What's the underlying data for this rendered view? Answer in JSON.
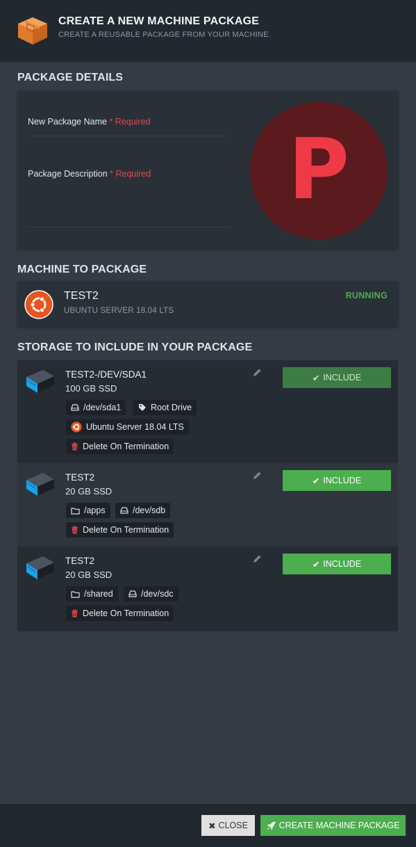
{
  "header": {
    "title": "CREATE A NEW MACHINE PACKAGE",
    "subtitle": "CREATE A REUSABLE PACKAGE FROM YOUR MACHINE.",
    "icon": "package-box-icon"
  },
  "package_details": {
    "title": "PACKAGE DETAILS",
    "name_label": "New Package Name",
    "description_label": "Package Description",
    "required_text": "* Required",
    "name_value": "",
    "description_value": "",
    "logo_letter": "P",
    "colors": {
      "logo_bg": "#5a1a1e",
      "logo_fg": "#ee3a45"
    }
  },
  "machine": {
    "title": "MACHINE TO PACKAGE",
    "name": "TEST2",
    "os": "UBUNTU SERVER 18.04 LTS",
    "status": "RUNNING",
    "icon": "ubuntu-icon"
  },
  "storage": {
    "title": "STORAGE TO INCLUDE IN YOUR PACKAGE",
    "items": [
      {
        "name": "TEST2-/DEV/SDA1",
        "size": "100 GB SSD",
        "include_label": "INCLUDE",
        "tags": {
          "device": "/dev/sda1",
          "role": "Root Drive",
          "os": "Ubuntu Server 18.04 LTS",
          "delete": "Delete On Termination"
        }
      },
      {
        "name": "TEST2",
        "size": "20 GB SSD",
        "include_label": "INCLUDE",
        "tags": {
          "mount": "/apps",
          "device": "/dev/sdb",
          "delete": "Delete On Termination"
        }
      },
      {
        "name": "TEST2",
        "size": "20 GB SSD",
        "include_label": "INCLUDE",
        "tags": {
          "mount": "/shared",
          "device": "/dev/sdc",
          "delete": "Delete On Termination"
        }
      }
    ]
  },
  "footer": {
    "close_label": "CLOSE",
    "create_label": "CREATE MACHINE PACKAGE"
  },
  "colors": {
    "accent_green": "#4cae4f",
    "required_red": "#e24a4f",
    "drive_blue": "#1aa3e8",
    "ubuntu_orange": "#e95420"
  }
}
